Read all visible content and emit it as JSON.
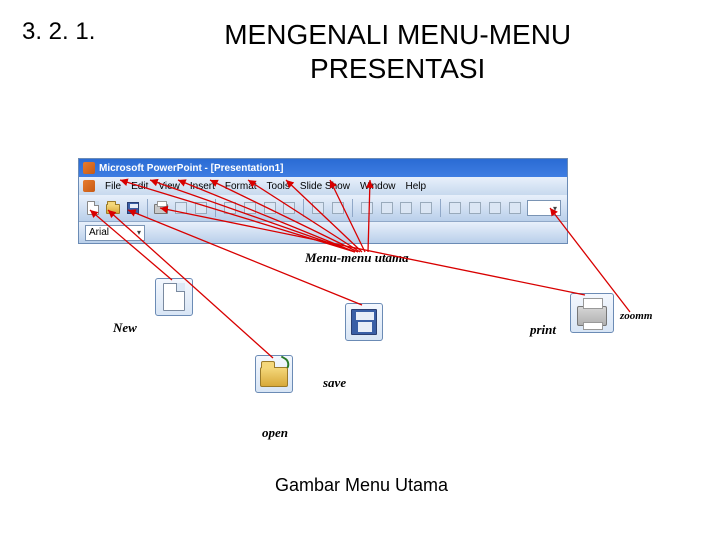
{
  "heading": {
    "section_number": "3. 2. 1.",
    "title_line1": "MENGENALI MENU-MENU",
    "title_line2": "PRESENTASI"
  },
  "screenshot": {
    "window_title": "Microsoft PowerPoint - [Presentation1]",
    "menus": [
      "File",
      "Edit",
      "View",
      "Insert",
      "Format",
      "Tools",
      "Slide Show",
      "Window",
      "Help"
    ],
    "font_name": "Arial",
    "zoom_value": ""
  },
  "annotations": {
    "menu_menu_utama": "Menu-menu utama",
    "new": "New",
    "print": "print",
    "zoom": "zoomm",
    "save": "save",
    "open": "open"
  },
  "caption": "Gambar Menu Utama"
}
